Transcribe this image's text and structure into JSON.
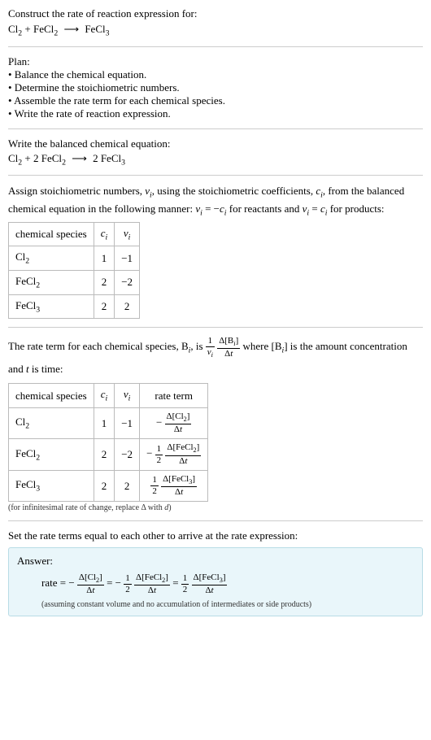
{
  "s1": {
    "line1": "Construct the rate of reaction expression for:"
  },
  "s2": {
    "title": "Plan:",
    "b1": "• Balance the chemical equation.",
    "b2": "• Determine the stoichiometric numbers.",
    "b3": "• Assemble the rate term for each chemical species.",
    "b4": "• Write the rate of reaction expression."
  },
  "s3": {
    "title": "Write the balanced chemical equation:"
  },
  "s4": {
    "intro_a": "Assign stoichiometric numbers, ",
    "intro_b": ", using the stoichiometric coefficients, ",
    "intro_c": ", from the balanced chemical equation in the following manner: ",
    "intro_d": " for reactants and ",
    "intro_e": " for products:",
    "nu_i": "ν",
    "ci": "c",
    "sub_i": "i",
    "eq1_lhs": "ν",
    "eq1_mid": " = −",
    "eq2_mid": " = ",
    "table": {
      "h1": "chemical species",
      "h2": "c",
      "h3": "ν",
      "hsub": "i",
      "r1": {
        "sp": "Cl",
        "spsub": "2",
        "c": "1",
        "n": "−1"
      },
      "r2": {
        "sp": "FeCl",
        "spsub": "2",
        "c": "2",
        "n": "−2"
      },
      "r3": {
        "sp": "FeCl",
        "spsub": "3",
        "c": "2",
        "n": "2"
      }
    }
  },
  "s5": {
    "intro_a": "The rate term for each chemical species, B",
    "intro_b": ", is ",
    "intro_c": " where [B",
    "intro_d": "] is the amount concentration and ",
    "intro_e": " is time:",
    "t_var": "t",
    "one": "1",
    "nu_i": "ν",
    "sub_i": "i",
    "delta": "Δ",
    "bb": "[B",
    "bb2": "]",
    "table": {
      "h1": "chemical species",
      "h2": "c",
      "h3": "ν",
      "h4": "rate term",
      "hsub": "i",
      "r1": {
        "sp": "Cl",
        "spsub": "2",
        "c": "1",
        "n": "−1"
      },
      "r2": {
        "sp": "FeCl",
        "spsub": "2",
        "c": "2",
        "n": "−2"
      },
      "r3": {
        "sp": "FeCl",
        "spsub": "3",
        "c": "2",
        "n": "2"
      }
    },
    "half_num": "1",
    "half_den": "2",
    "dCl2": "Δ[Cl",
    "dFeCl2": "Δ[FeCl",
    "dFeCl3": "Δ[FeCl",
    "br": "]",
    "dt": "t",
    "note": "(for infinitesimal rate of change, replace Δ with ",
    "note_d": "d",
    "note_end": ")"
  },
  "s6": {
    "title": "Set the rate terms equal to each other to arrive at the rate expression:"
  },
  "ans": {
    "label": "Answer:",
    "rate": "rate = −",
    "eq": " = −",
    "eq2": " = ",
    "half_num": "1",
    "half_den": "2",
    "dCl2": "Δ[Cl",
    "dFeCl2": "Δ[FeCl",
    "dFeCl3": "Δ[FeCl",
    "sub2": "2",
    "sub3": "3",
    "br": "]",
    "delta": "Δ",
    "t": "t",
    "note": "(assuming constant volume and no accumulation of intermediates or side products)"
  },
  "eq1": {
    "cl2": "Cl",
    "cl2s": "2",
    "plus": " + ",
    "fecl2": "FeCl",
    "fecl2s": "2",
    "arr": "⟶",
    "fecl3": "FeCl",
    "fecl3s": "3"
  },
  "eq2": {
    "cl2": "Cl",
    "cl2s": "2",
    "plus": " + 2 ",
    "fecl2": "FeCl",
    "fecl2s": "2",
    "arr": "⟶",
    "two": " 2 ",
    "fecl3": "FeCl",
    "fecl3s": "3"
  }
}
